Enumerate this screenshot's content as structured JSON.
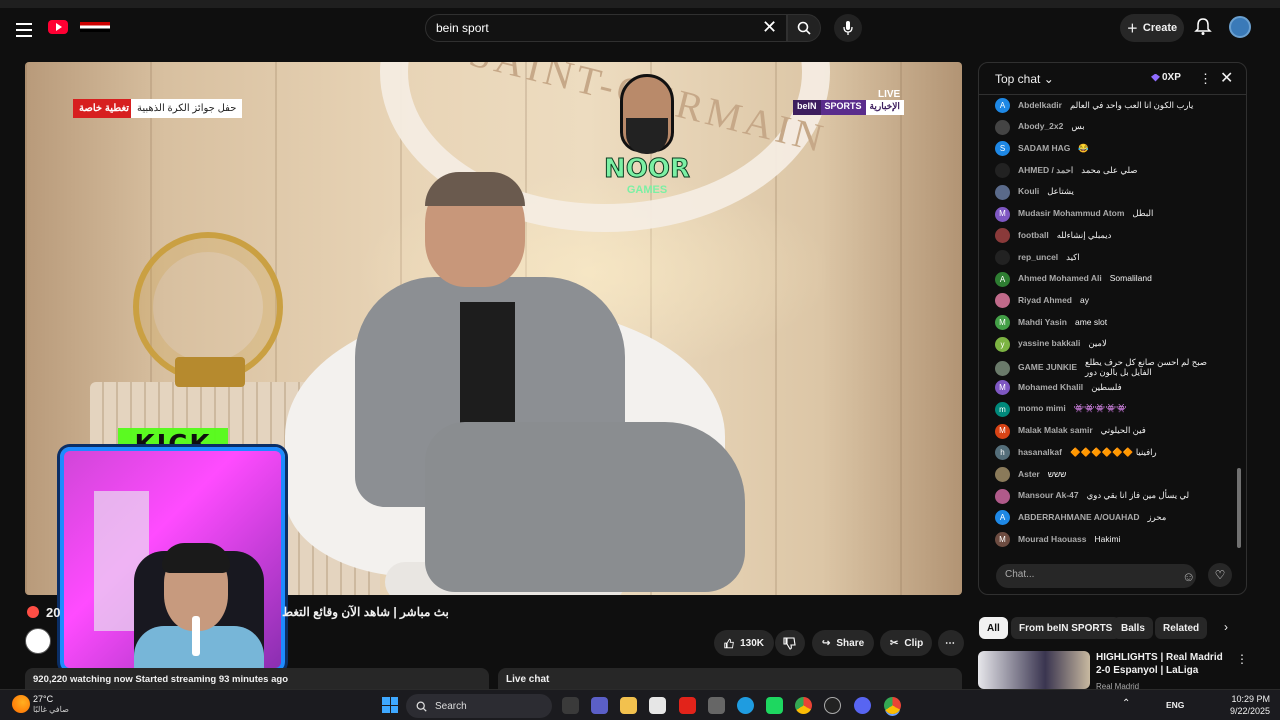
{
  "browser": {
    "tabs_visible": true
  },
  "masthead": {
    "search_value": "bein sport",
    "create_label": "Create"
  },
  "video": {
    "badge_red": "تغطية خاصة",
    "badge_white": "حفل جوائز الكرة الذهبية",
    "live_label": "LIVE",
    "channel_logo": {
      "bein": "beIN",
      "sports": "SPORTS",
      "news": "الإخبارية"
    },
    "stadium_text": "SAINT-GERMAIN",
    "overlay_logo": {
      "main": "NOOR",
      "sub": "GAMES"
    },
    "kick_label": "KICK"
  },
  "below_video": {
    "viewer_prefix": "20",
    "title": "بث مباشر | شاهد الآن وقائع التغط",
    "like_count": "130K",
    "share_label": "Share",
    "clip_label": "Clip",
    "meta_text": "920,220 watching now  Started streaming 93 minutes ago",
    "live_chat_label": "Live chat"
  },
  "chat": {
    "header": "Top chat",
    "xp": "0XP",
    "input_placeholder": "Chat...",
    "messages": [
      {
        "name": "Abdelkadir",
        "text": "يارب الكون انا العب واحد في العالم",
        "color": "#1e88e5",
        "initial": "A"
      },
      {
        "name": "Abody_2x2",
        "text": "بس",
        "color": "#444",
        "initial": ""
      },
      {
        "name": "SADAM HAG",
        "text": "😂",
        "color": "#1e88e5",
        "initial": "S"
      },
      {
        "name": "AHMED / احمد",
        "text": "صلي على محمد",
        "color": "#222",
        "initial": ""
      },
      {
        "name": "Kouli",
        "text": "يشتاعل",
        "color": "#5a6a8a",
        "initial": ""
      },
      {
        "name": "Mudasir Mohammud Atom",
        "text": "البطل",
        "color": "#7e57c2",
        "initial": "M"
      },
      {
        "name": "football",
        "text": "ديمبلي إنشاءلله",
        "color": "#8a3a3a",
        "initial": ""
      },
      {
        "name": "rep_uncel",
        "text": "اكيد",
        "color": "#222",
        "initial": ""
      },
      {
        "name": "Ahmed Mohamed Ali",
        "text": "Somaliland",
        "color": "#2e7d32",
        "initial": "A"
      },
      {
        "name": "Riyad Ahmed",
        "text": "ay",
        "color": "#c06a8a",
        "initial": ""
      },
      {
        "name": "Mahdi Yasin",
        "text": "ame slot",
        "color": "#43a047",
        "initial": "M"
      },
      {
        "name": "yassine bakkali",
        "text": "لامين",
        "color": "#7cb342",
        "initial": "y"
      },
      {
        "name": "GAME JUNKIE",
        "text": "صبح لم احسن صانع كل حرف يطلع الفايل بل بالون دور",
        "color": "#6a7a6a",
        "initial": ""
      },
      {
        "name": "Mohamed Khalil",
        "text": "فلسطين",
        "color": "#7e57c2",
        "initial": "M"
      },
      {
        "name": "momo mimi",
        "text": "👾👾👾👾👾",
        "color": "#00897b",
        "initial": "m"
      },
      {
        "name": "Malak Malak samir",
        "text": "فين الحيلوتي",
        "color": "#d84315",
        "initial": "M"
      },
      {
        "name": "hasanalkaf",
        "text": "🔶🔶🔶🔶🔶🔶 رافينيا",
        "color": "#546e7a",
        "initial": "h"
      },
      {
        "name": "Aster",
        "text": "ששש",
        "color": "#8a7a5a",
        "initial": ""
      },
      {
        "name": "Mansour Ak-47",
        "text": "لي يسأل مين فاز انا بقي دوي",
        "color": "#b05a8a",
        "initial": ""
      },
      {
        "name": "ABDERRAHMANE A/OUAHAD",
        "text": "محرز",
        "color": "#1e88e5",
        "initial": "A"
      },
      {
        "name": "Mourad Haouass",
        "text": "Hakimi",
        "color": "#6d4c41",
        "initial": "M"
      }
    ]
  },
  "chips": [
    "All",
    "From beIN SPORTS",
    "Balls",
    "Related"
  ],
  "recommendation": {
    "title": "HIGHLIGHTS | Real Madrid 2-0 Espanyol | LaLiga",
    "channel": "Real Madrid"
  },
  "taskbar": {
    "temp": "27°C",
    "condition": "صافي غالبًا",
    "search_label": "Search",
    "lang": "ENG",
    "time": "10:29 PM",
    "date": "9/22/2025"
  },
  "colors": {
    "accent": "#ff0033",
    "kick": "#53fc18",
    "cam_border": "#1e8bff"
  }
}
